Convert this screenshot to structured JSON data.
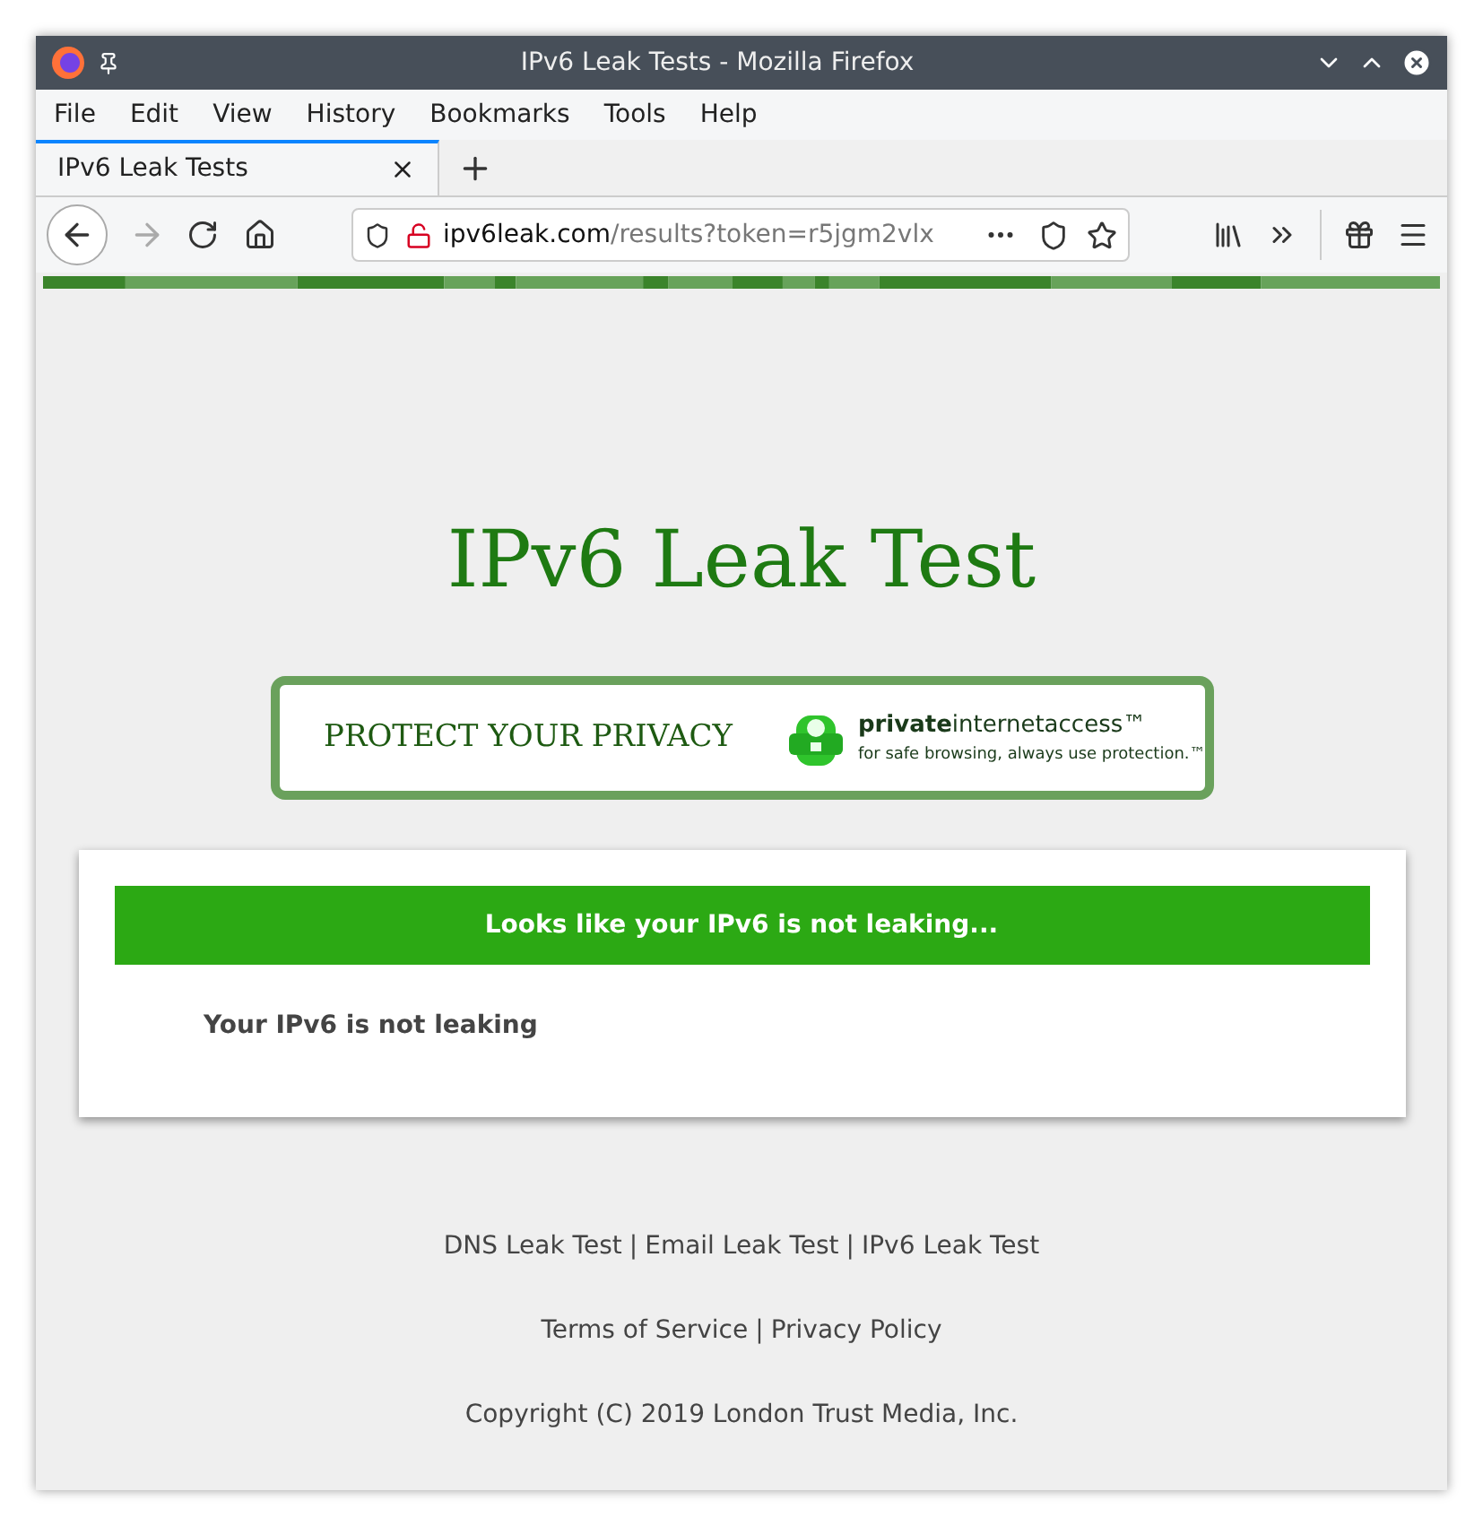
{
  "window": {
    "title": "IPv6 Leak Tests - Mozilla Firefox"
  },
  "menu": [
    "File",
    "Edit",
    "View",
    "History",
    "Bookmarks",
    "Tools",
    "Help"
  ],
  "tabs": [
    {
      "label": "IPv6 Leak Tests",
      "selected": true
    }
  ],
  "address": {
    "host": "ipv6leak.com",
    "path": "/results?token=r5jgm2vlx"
  },
  "page": {
    "heading": "IPv6 Leak Test",
    "banner": {
      "slogan": "PROTECT YOUR PRIVACY",
      "brand": "**private**internetaccess™",
      "tagline": "for safe browsing, always use protection.™"
    },
    "result": {
      "status": "Looks like your IPv6 is not leaking...",
      "leaking": false,
      "detail": "Your IPv6 is not leaking"
    },
    "footer_links": [
      {
        "label": "DNS Leak Test"
      },
      {
        "label": "Email Leak Test"
      },
      {
        "label": "IPv6 Leak Test"
      }
    ],
    "policy_links": [
      {
        "label": "Terms of Service"
      },
      {
        "label": "Privacy Policy"
      }
    ],
    "separator": "|",
    "copyright": "Copyright (C) 2019 London Trust Media, Inc."
  }
}
